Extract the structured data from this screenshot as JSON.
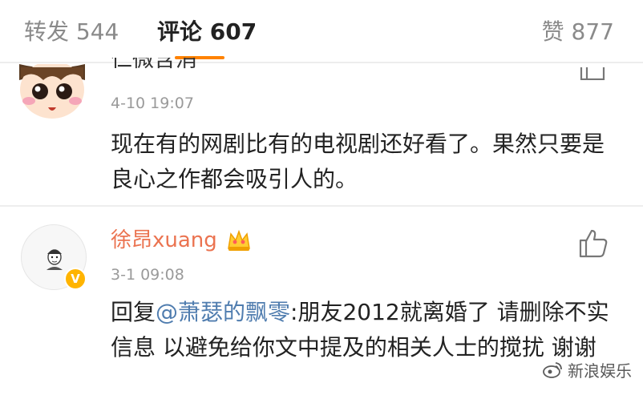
{
  "tabs": {
    "repost": "转发 544",
    "comment": "评论 607",
    "like": "赞 877"
  },
  "comments": [
    {
      "user_name": "仁微含消",
      "avatar_icon": "cartoon-face-avatar",
      "time": "4-10 19:07",
      "text": "现在有的网剧比有的电视剧还好看了。果然只要是良心之作都会吸引人的。"
    },
    {
      "user_name": "徐昂xuang",
      "avatar_icon": "sketch-portrait-avatar",
      "verified_badge": "V",
      "member_icon": "crown-icon",
      "time": "3-1 09:08",
      "reply_prefix": "回复",
      "mention": "@萧瑟的飘零",
      "text": ":朋友2012就离婚了 请删除不实信息 以避免给你文中提及的相关人士的搅扰 谢谢"
    }
  ],
  "watermark": {
    "text": "新浪娱乐",
    "icon": "weibo-logo-icon"
  },
  "colors": {
    "accent": "#ff8200",
    "vip_name": "#eb7350",
    "mention": "#507daf",
    "muted": "#9a9a9a"
  }
}
